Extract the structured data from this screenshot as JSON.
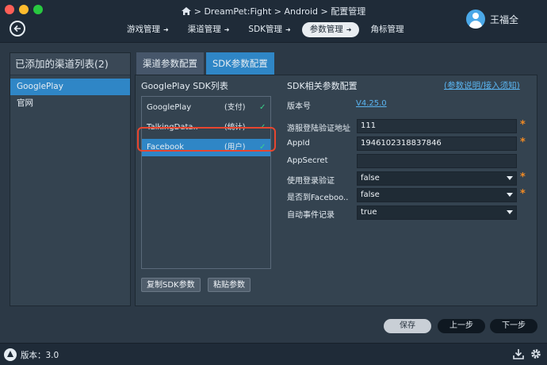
{
  "header": {
    "breadcrumb": "> DreamPet:Fight > Android > 配置管理",
    "user_name": "王福全",
    "nav_tabs": [
      {
        "label": "游戏管理"
      },
      {
        "label": "渠道管理"
      },
      {
        "label": "SDK管理"
      },
      {
        "label": "参数管理"
      },
      {
        "label": "角标管理"
      }
    ],
    "active_nav": "参数管理"
  },
  "left_panel": {
    "title": "已添加的渠道列表(2)",
    "items": [
      {
        "label": "GooglePlay",
        "selected": true
      },
      {
        "label": "官网",
        "selected": false
      }
    ]
  },
  "tabs": [
    {
      "label": "渠道参数配置",
      "active": false
    },
    {
      "label": "SDK参数配置",
      "active": true
    }
  ],
  "sdk_list": {
    "title": "GooglePlay SDK列表",
    "items": [
      {
        "name": "GooglePlay",
        "tag": "(支付)",
        "check": "✓",
        "selected": false
      },
      {
        "name": "TalkingData..",
        "tag": "(统计)",
        "check": "✓",
        "selected": false
      },
      {
        "name": "Facebook",
        "tag": "(用户)",
        "check": "✓",
        "selected": true
      }
    ],
    "copy_button": "复制SDK参数",
    "paste_button": "粘贴参数"
  },
  "config": {
    "title": "SDK相关参数配置",
    "help_link": "(参数说明/接入须知)",
    "version_label": "版本号",
    "version_value": "V4.25.0",
    "fields": [
      {
        "label": "游服登陆验证地址",
        "value": "111",
        "required": "*"
      },
      {
        "label": "AppId",
        "value": "1946102318837846",
        "required": "*"
      },
      {
        "label": "AppSecret",
        "value": "",
        "required": ""
      },
      {
        "label": "使用登录验证",
        "value": "false",
        "required": "*"
      },
      {
        "label": "是否到Faceboo..",
        "value": "false",
        "required": "*"
      },
      {
        "label": "自动事件记录",
        "value": "true",
        "required": ""
      }
    ]
  },
  "footer": {
    "save": "保存",
    "prev": "上一步",
    "next": "下一步"
  },
  "status": {
    "version": "版本：3.0"
  },
  "colors": {
    "accent": "#2f86c6",
    "required_star": "#f08a24",
    "highlight_box": "#e8462f",
    "check": "#3ad38a"
  }
}
